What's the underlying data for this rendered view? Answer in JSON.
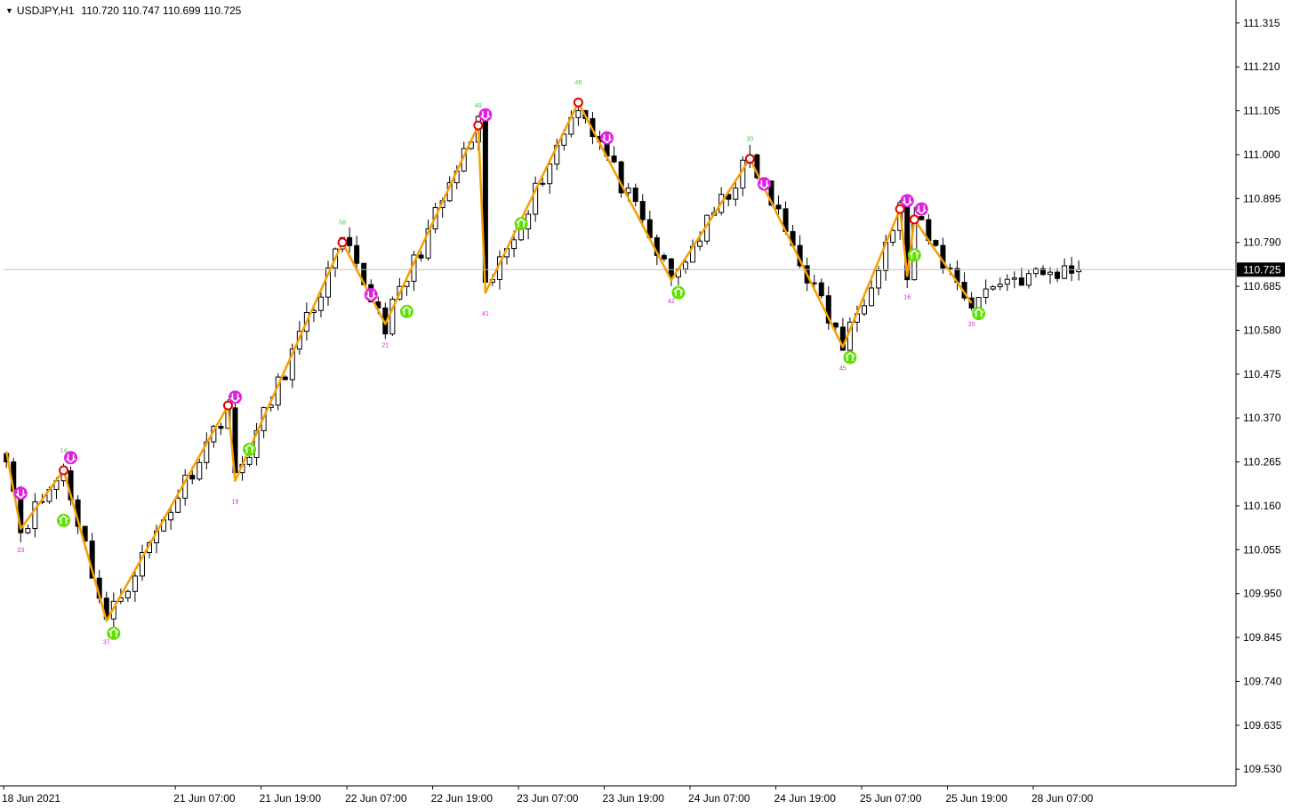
{
  "header": {
    "symbol_label": "USDJPY,H1",
    "ohlc_label": "110.720 110.747 110.699 110.725",
    "menu_icon": "triangle-down-icon"
  },
  "chart_data": {
    "type": "candlestick",
    "symbol": "USDJPY",
    "timeframe": "H1",
    "current_price": 110.725,
    "current_price_label": "110.725",
    "ylim": [
      109.49,
      111.37
    ],
    "y_ticks": [
      "111.315",
      "111.210",
      "111.105",
      "111.000",
      "110.895",
      "110.790",
      "110.685",
      "110.580",
      "110.475",
      "110.370",
      "110.265",
      "110.160",
      "110.055",
      "109.950",
      "109.845",
      "109.740",
      "109.635",
      "109.530"
    ],
    "x_tick_labels": [
      "18 Jun 2021",
      "21 Jun 07:00",
      "21 Jun 19:00",
      "22 Jun 07:00",
      "22 Jun 19:00",
      "23 Jun 07:00",
      "23 Jun 19:00",
      "24 Jun 07:00",
      "24 Jun 19:00",
      "25 Jun 07:00",
      "25 Jun 19:00",
      "28 Jun 07:00"
    ],
    "x_tick_bars": [
      0,
      24,
      36,
      48,
      60,
      72,
      84,
      96,
      108,
      120,
      132,
      144
    ],
    "bar_count": 151,
    "grid": false,
    "colors": {
      "background": "#ffffff",
      "candle_up_body": "#ffffff",
      "candle_down_body": "#000000",
      "wick": "#000000",
      "zigzag": "#f5a000",
      "pivot_circle": "#e00000",
      "top_marker": "#e020e0",
      "bottom_marker": "#60e000",
      "label_top": "#40d040",
      "label_bottom": "#e020e0",
      "price_box": "#000000",
      "price_line": "#c0c0c0"
    },
    "zigzag": [
      {
        "bar": 0,
        "price": 110.29
      },
      {
        "bar": 2,
        "price": 110.105
      },
      {
        "bar": 8,
        "price": 110.245
      },
      {
        "bar": 14,
        "price": 109.885
      },
      {
        "bar": 31,
        "price": 110.4
      },
      {
        "bar": 32,
        "price": 110.22
      },
      {
        "bar": 47,
        "price": 110.79
      },
      {
        "bar": 53,
        "price": 110.595
      },
      {
        "bar": 66,
        "price": 111.07
      },
      {
        "bar": 67,
        "price": 110.67
      },
      {
        "bar": 80,
        "price": 111.125
      },
      {
        "bar": 93,
        "price": 110.7
      },
      {
        "bar": 104,
        "price": 110.99
      },
      {
        "bar": 117,
        "price": 110.54
      },
      {
        "bar": 125,
        "price": 110.87
      },
      {
        "bar": 126,
        "price": 110.71
      },
      {
        "bar": 127,
        "price": 110.845
      },
      {
        "bar": 135,
        "price": 110.645
      }
    ],
    "top_labels": [
      {
        "bar": 8,
        "price": 110.245,
        "text": "14"
      },
      {
        "bar": 47,
        "price": 110.79,
        "text": "58"
      },
      {
        "bar": 66,
        "price": 111.07,
        "text": "48"
      },
      {
        "bar": 80,
        "price": 111.125,
        "text": "46"
      },
      {
        "bar": 104,
        "price": 110.99,
        "text": "30"
      }
    ],
    "bottom_labels": [
      {
        "bar": 2,
        "price": 110.105,
        "text": "23"
      },
      {
        "bar": 14,
        "price": 109.885,
        "text": "37"
      },
      {
        "bar": 32,
        "price": 110.22,
        "text": "19"
      },
      {
        "bar": 53,
        "price": 110.595,
        "text": "21"
      },
      {
        "bar": 67,
        "price": 110.67,
        "text": "41"
      },
      {
        "bar": 93,
        "price": 110.7,
        "text": "42"
      },
      {
        "bar": 117,
        "price": 110.54,
        "text": "45"
      },
      {
        "bar": 126,
        "price": 110.71,
        "text": "16"
      },
      {
        "bar": 135,
        "price": 110.645,
        "text": "20"
      }
    ],
    "pivot_circles": [
      {
        "bar": 8,
        "price": 110.245
      },
      {
        "bar": 31,
        "price": 110.4
      },
      {
        "bar": 47,
        "price": 110.79
      },
      {
        "bar": 66,
        "price": 111.07
      },
      {
        "bar": 80,
        "price": 111.125
      },
      {
        "bar": 104,
        "price": 110.99
      },
      {
        "bar": 125,
        "price": 110.87
      },
      {
        "bar": 127,
        "price": 110.845
      }
    ],
    "sell_markers": [
      {
        "bar": 2,
        "price": 110.19
      },
      {
        "bar": 9,
        "price": 110.275
      },
      {
        "bar": 32,
        "price": 110.42
      },
      {
        "bar": 51,
        "price": 110.665
      },
      {
        "bar": 67,
        "price": 111.095
      },
      {
        "bar": 84,
        "price": 111.04
      },
      {
        "bar": 106,
        "price": 110.93
      },
      {
        "bar": 126,
        "price": 110.89
      },
      {
        "bar": 128,
        "price": 110.87
      }
    ],
    "buy_markers": [
      {
        "bar": 8,
        "price": 110.125
      },
      {
        "bar": 15,
        "price": 109.855
      },
      {
        "bar": 34,
        "price": 110.295
      },
      {
        "bar": 56,
        "price": 110.625
      },
      {
        "bar": 72,
        "price": 110.835
      },
      {
        "bar": 94,
        "price": 110.67
      },
      {
        "bar": 118,
        "price": 110.515
      },
      {
        "bar": 127,
        "price": 110.76
      },
      {
        "bar": 136,
        "price": 110.62
      }
    ]
  }
}
